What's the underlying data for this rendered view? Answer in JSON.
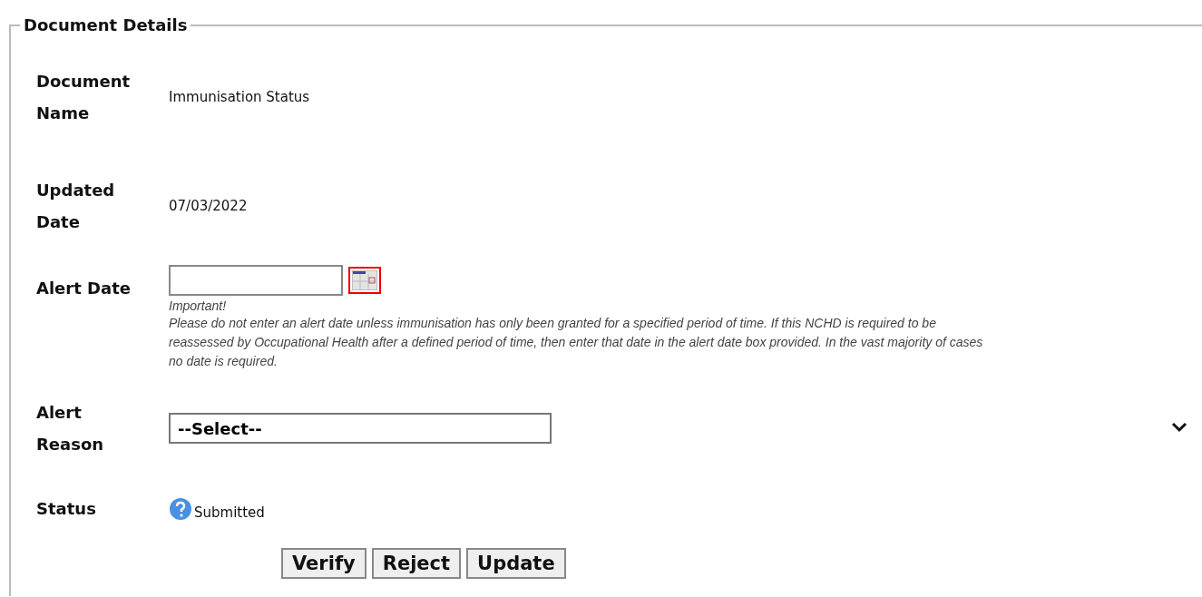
{
  "fieldset": {
    "legend": "Document Details",
    "fields": [
      {
        "kind": "text",
        "label": "Document Name",
        "value": "Immunisation Status"
      },
      {
        "kind": "text",
        "label": "Updated Date",
        "value": "07/03/2022"
      },
      {
        "kind": "date",
        "label": "Alert Date",
        "note_title": "Important!",
        "note": "Please do not enter an alert date unless immunisation has only been granted for a specified period of time. If this NCHD is required to be reassessed by Occupational Health after a defined period of time, then enter that date in the alert date box provided. In the vast majority of cases no date is required."
      },
      {
        "kind": "select",
        "label": "Alert Reason",
        "value": "--Select--"
      },
      {
        "kind": "status",
        "label": "Status",
        "value": "Submitted"
      }
    ],
    "buttons": [
      "Verify",
      "Reject",
      "Update"
    ]
  }
}
